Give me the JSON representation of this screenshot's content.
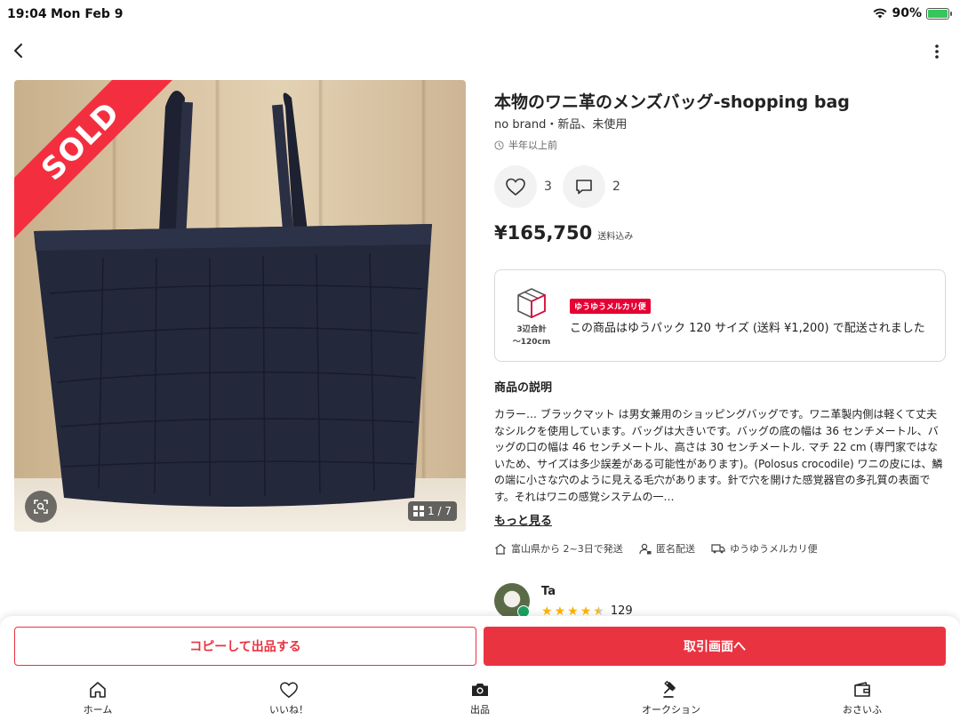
{
  "status_bar": {
    "time": "19:04",
    "date": "Mon Feb 9",
    "battery": "90%"
  },
  "listing": {
    "title": "本物のワニ革のメンズバッグ-shopping bag",
    "subtitle": "no brand・新品、未使用",
    "posted": "半年以上前",
    "likes": "3",
    "comments": "2",
    "price": "¥165,750",
    "price_note": "送料込み",
    "sold_label": "SOLD",
    "image_counter": "1 / 7"
  },
  "shipping_card": {
    "size_label_line1": "3辺合計",
    "size_label_line2": "～120cm",
    "badge": "ゆうゆうメルカリ便",
    "text": "この商品はゆうパック 120 サイズ (送料 ¥1,200) で配送されました"
  },
  "description": {
    "heading": "商品の説明",
    "body": "カラー… ブラックマット は男女兼用のショッピングバッグです。ワニ革製内側は軽くて丈夫なシルクを使用しています。バッグは大きいです。バッグの底の幅は 36 センチメートル、バッグの口の幅は 46 センチメートル、高さは 30 センチメートル. マチ 22 cm (専門家ではないため、サイズは多少誤差がある可能性があります)。(Polosus crocodile) ワニの皮には、鱗の端に小さな穴のように見える毛穴があります。針で穴を開けた感覚器官の多孔質の表面です。それはワニの感覚システムの一…",
    "more": "もっと見る"
  },
  "meta": {
    "ship_from": "富山県から 2~3日で発送",
    "anonymous": "匿名配送",
    "method": "ゆうゆうメルカリ便"
  },
  "seller": {
    "name": "Ta",
    "rating": 4.5,
    "reviews": "129"
  },
  "actions": {
    "copy": "コピーして出品する",
    "trade": "取引画面へ"
  },
  "tabs": [
    {
      "label": "ホーム",
      "icon": "home-icon"
    },
    {
      "label": "いいね！",
      "icon": "heart-icon"
    },
    {
      "label": "出品",
      "icon": "camera-icon"
    },
    {
      "label": "オークション",
      "icon": "gavel-icon"
    },
    {
      "label": "おさいふ",
      "icon": "wallet-icon"
    }
  ],
  "colors": {
    "accent": "#ea3341",
    "sold": "#f32f3f",
    "badge": "#e60033",
    "star": "#ffb400"
  }
}
